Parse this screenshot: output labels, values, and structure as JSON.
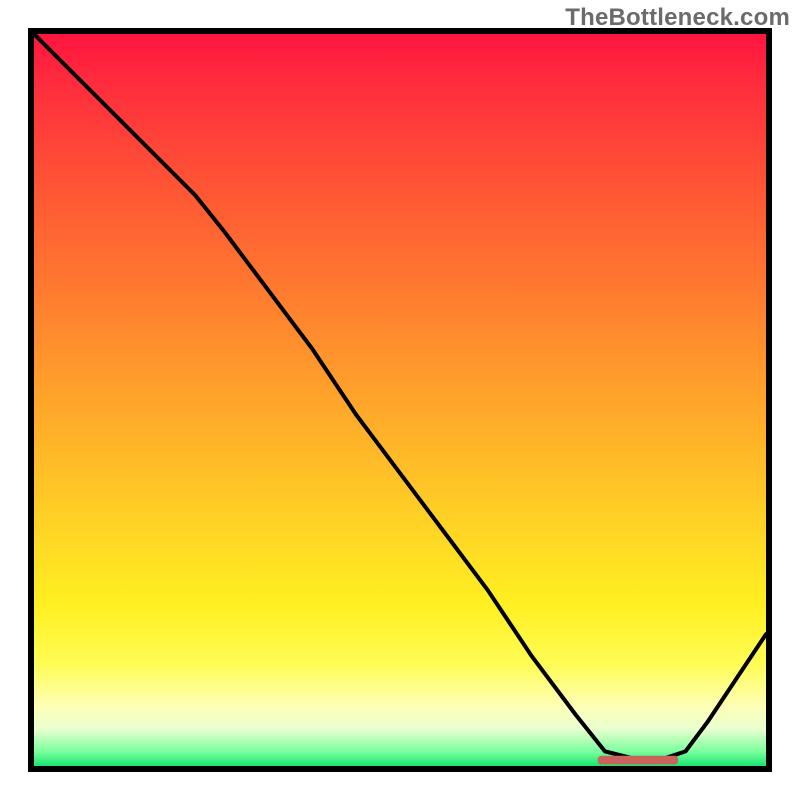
{
  "watermark": "TheBottleneck.com",
  "colors": {
    "border": "#000000",
    "line": "#000000",
    "marker": "#c9635b"
  },
  "chart_data": {
    "type": "line",
    "title": "",
    "xlabel": "",
    "ylabel": "",
    "xlim": [
      0,
      100
    ],
    "ylim": [
      0,
      100
    ],
    "grid": false,
    "legend": false,
    "annotations": [],
    "series": [
      {
        "name": "bottleneck_curve",
        "x": [
          0,
          6,
          12,
          18,
          22,
          26,
          32,
          38,
          44,
          50,
          56,
          62,
          68,
          74,
          78,
          82,
          86,
          89,
          92,
          96,
          100
        ],
        "y": [
          100,
          94,
          88,
          82,
          78,
          73,
          65,
          57,
          48,
          40,
          32,
          24,
          15,
          7,
          2,
          1,
          1,
          2,
          6,
          12,
          18
        ]
      }
    ],
    "marker_segment": {
      "x_start": 77,
      "x_end": 88,
      "y": 0.8,
      "label": ""
    }
  }
}
